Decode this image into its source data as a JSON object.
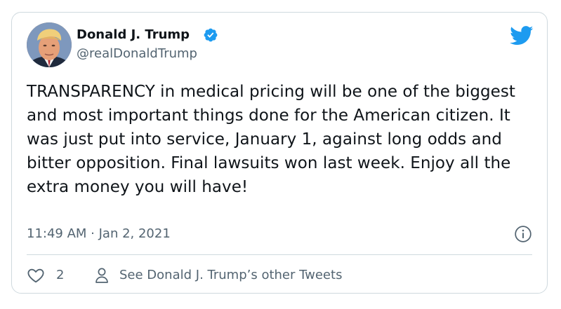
{
  "tweet": {
    "author_name": "Donald J. Trump",
    "author_handle": "@realDonaldTrump",
    "text": "TRANSPARENCY in medical pricing will be one of the biggest and most important things done for the American citizen. It was just put into service, January 1, against long odds and bitter opposition. Final lawsuits won last week. Enjoy all the extra money you will have!",
    "timestamp": "11:49 AM · Jan 2, 2021",
    "like_count": "2",
    "other_tweets_label": "See Donald J. Trump’s other Tweets"
  },
  "icons": {
    "verified": "verified-badge-icon",
    "brand": "twitter-bird-icon",
    "info": "info-icon",
    "like": "heart-icon",
    "profile": "person-icon"
  },
  "colors": {
    "brand": "#1d9bf0",
    "text_primary": "#0f1419",
    "text_secondary": "#536471",
    "border": "#cfd9de"
  }
}
